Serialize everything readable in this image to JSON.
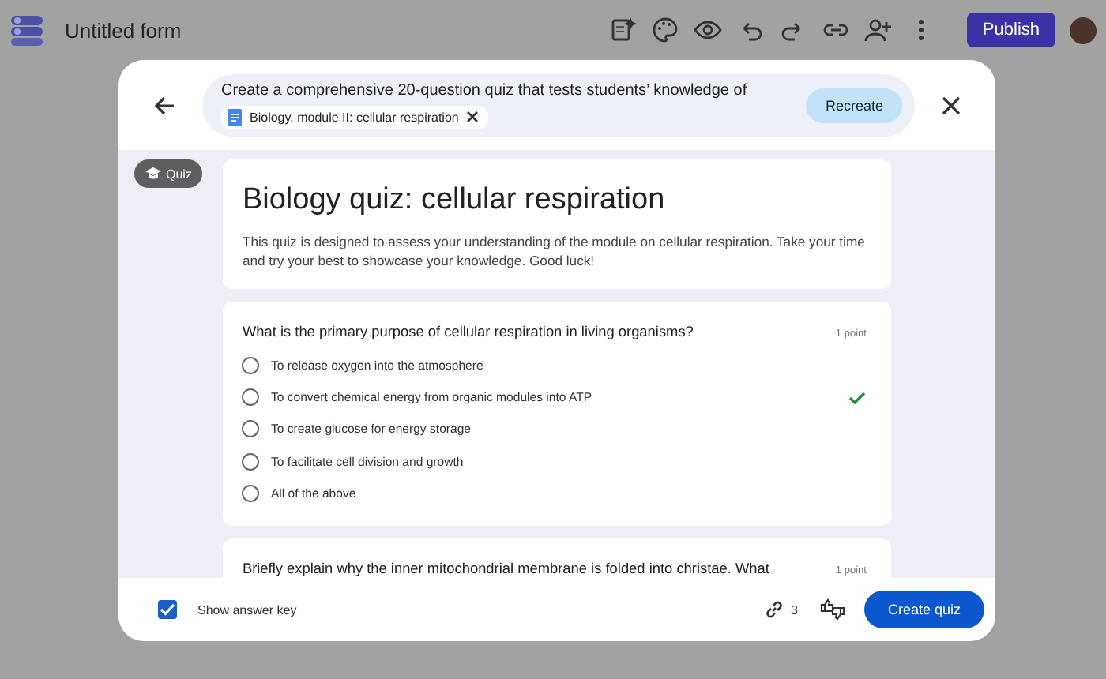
{
  "app_bar": {
    "title": "Untitled form",
    "publish_button": "Publish"
  },
  "dialog": {
    "prompt": {
      "text": "Create a comprehensive 20-question quiz that tests students’ knowledge of",
      "attachment": "Biology, module II: cellular respiration",
      "recreate_button": "Recreate"
    },
    "badge": "Quiz",
    "form": {
      "title": "Biology quiz: cellular respiration",
      "description": "This quiz is designed to assess your understanding of the module on cellular respiration. Take your time and try your best to showcase your knowledge. Good luck!"
    },
    "questions": [
      {
        "text": "What is the primary purpose of cellular respiration in living organisms?",
        "points": "1 point",
        "options": [
          {
            "label": "To release oxygen into the atmosphere",
            "correct": false,
            "selected": false
          },
          {
            "label": "To convert chemical energy from organic modules into ATP",
            "correct": true,
            "selected": false
          },
          {
            "label": "To create glucose for energy storage",
            "correct": false,
            "selected": false
          },
          {
            "label": "To facilitate cell division and growth",
            "correct": false,
            "selected": false
          },
          {
            "label": "All of the above",
            "correct": false,
            "selected": false
          }
        ]
      },
      {
        "text": "Briefly explain why the inner mitochondrial membrane is folded into christae. What",
        "points": "1 point"
      }
    ],
    "footer": {
      "show_answer_key": {
        "label": "Show answer key",
        "checked": true
      },
      "source_count": "3",
      "create_button": "Create quiz"
    }
  }
}
